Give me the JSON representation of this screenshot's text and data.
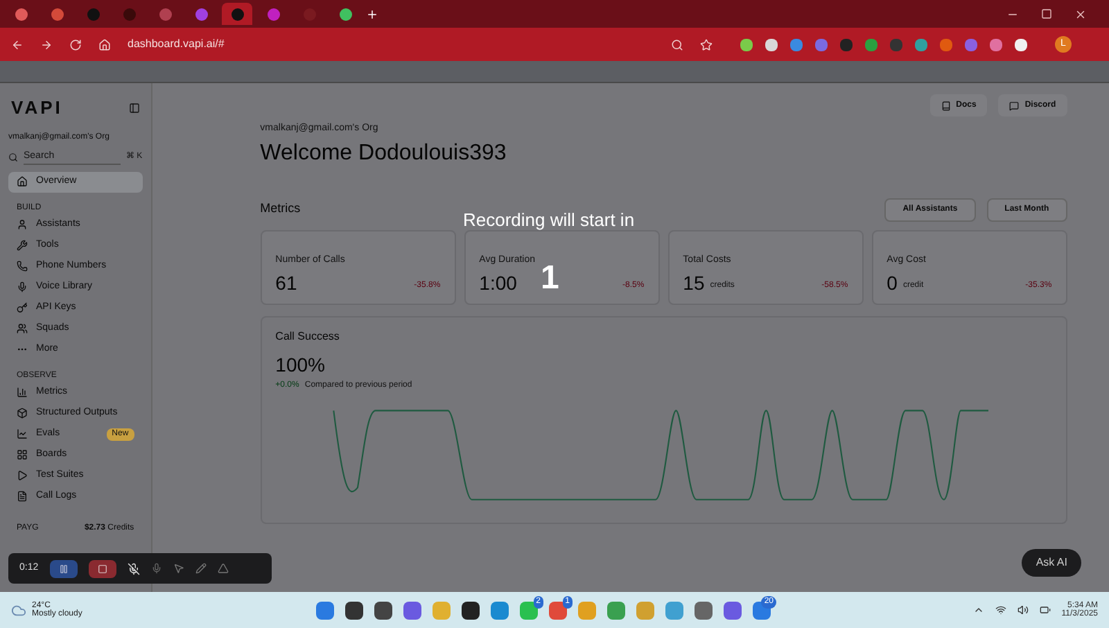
{
  "browser": {
    "tabs": [
      {
        "color": "#e05a5a",
        "selected": false
      },
      {
        "color": "#d44a3a",
        "selected": false
      },
      {
        "color": "#111111",
        "selected": false
      },
      {
        "color": "#3a0a0a",
        "selected": false
      },
      {
        "color": "#b04050",
        "selected": false
      },
      {
        "color": "#a040e0",
        "selected": false
      },
      {
        "color": "#111111",
        "selected": true
      },
      {
        "color": "#c020c0",
        "selected": false
      },
      {
        "color": "#7a1a20",
        "selected": false
      },
      {
        "color": "#40c060",
        "selected": false
      }
    ],
    "address": "dashboard.vapi.ai/#",
    "extensions": [
      {
        "color": "#7acb4a"
      },
      {
        "color": "#d8d8d8"
      },
      {
        "color": "#3a8ae0"
      },
      {
        "color": "#7a6ae0"
      },
      {
        "color": "#222222"
      },
      {
        "color": "#2aa040"
      },
      {
        "color": "#333333"
      },
      {
        "color": "#30a0a0"
      },
      {
        "color": "#e05a10"
      },
      {
        "color": "#8a60e0"
      },
      {
        "color": "#e070a0"
      },
      {
        "color": "#f0f0f0"
      }
    ],
    "profile": "L"
  },
  "sidebar": {
    "logo": "VAPI",
    "org": "vmalkanj@gmail.com's Org",
    "search": {
      "placeholder": "Search",
      "shortcut": "⌘ K"
    },
    "top_items": [
      {
        "label": "Overview",
        "selected": true
      }
    ],
    "sections": [
      {
        "title": "BUILD",
        "items": [
          {
            "label": "Assistants",
            "selected": false
          },
          {
            "label": "Tools",
            "selected": false
          },
          {
            "label": "Phone Numbers",
            "selected": false
          },
          {
            "label": "Voice Library",
            "selected": false
          },
          {
            "label": "API Keys",
            "selected": false
          },
          {
            "label": "Squads",
            "selected": false
          },
          {
            "label": "More",
            "selected": false
          }
        ]
      },
      {
        "title": "OBSERVE",
        "items": [
          {
            "label": "Metrics",
            "selected": false
          },
          {
            "label": "Structured Outputs",
            "selected": false
          },
          {
            "label": "Evals",
            "selected": false,
            "badge": "New"
          },
          {
            "label": "Boards",
            "selected": false
          },
          {
            "label": "Test Suites",
            "selected": false
          },
          {
            "label": "Call Logs",
            "selected": false
          }
        ]
      }
    ],
    "plan": "PAYG",
    "credits": "$2.73",
    "credits_unit": "Credits"
  },
  "main": {
    "org": "vmalkanj@gmail.com's Org",
    "title": "Welcome Dodoulouis393",
    "header_buttons": [
      "Docs",
      "Discord"
    ],
    "metrics_title": "Metrics",
    "filters": [
      "All Assistants",
      "Last Month"
    ],
    "cards": [
      {
        "label": "Number of Calls",
        "value": "61",
        "delta": "-35.8%"
      },
      {
        "label": "Avg Duration",
        "value": "1:00",
        "delta": "-8.5%"
      },
      {
        "label": "Total Costs",
        "value": "15",
        "unit": "credits",
        "delta": "-58.5%"
      },
      {
        "label": "Avg Cost",
        "value": "0",
        "unit": "credit",
        "delta": "-35.3%"
      }
    ],
    "success": {
      "title": "Call Success",
      "value": "100%",
      "delta": "+0.0%",
      "note": "Compared to previous period"
    },
    "ask_ai": "Ask AI"
  },
  "countdown": {
    "title": "Recording will start in",
    "number": "1"
  },
  "recorder": {
    "time": "0:12"
  },
  "taskbar": {
    "temperature": "24°C",
    "weather": "Mostly cloudy",
    "time": "5:34 AM",
    "date": "11/3/2025",
    "apps": [
      {
        "color": "#2a7ae0"
      },
      {
        "color": "#333333"
      },
      {
        "color": "#444444"
      },
      {
        "color": "#6a5ae0"
      },
      {
        "color": "#e0b030"
      },
      {
        "color": "#222222"
      },
      {
        "color": "#1a8ad0"
      },
      {
        "color": "#2ac050",
        "badge": "2"
      },
      {
        "color": "#e04a3a",
        "badge": "1"
      },
      {
        "color": "#e0a020"
      },
      {
        "color": "#3aa050"
      },
      {
        "color": "#d0a030"
      },
      {
        "color": "#40a0d0"
      },
      {
        "color": "#666666"
      },
      {
        "color": "#6a5ae0"
      },
      {
        "color": "#2a7ae0",
        "badge": "20"
      }
    ]
  }
}
